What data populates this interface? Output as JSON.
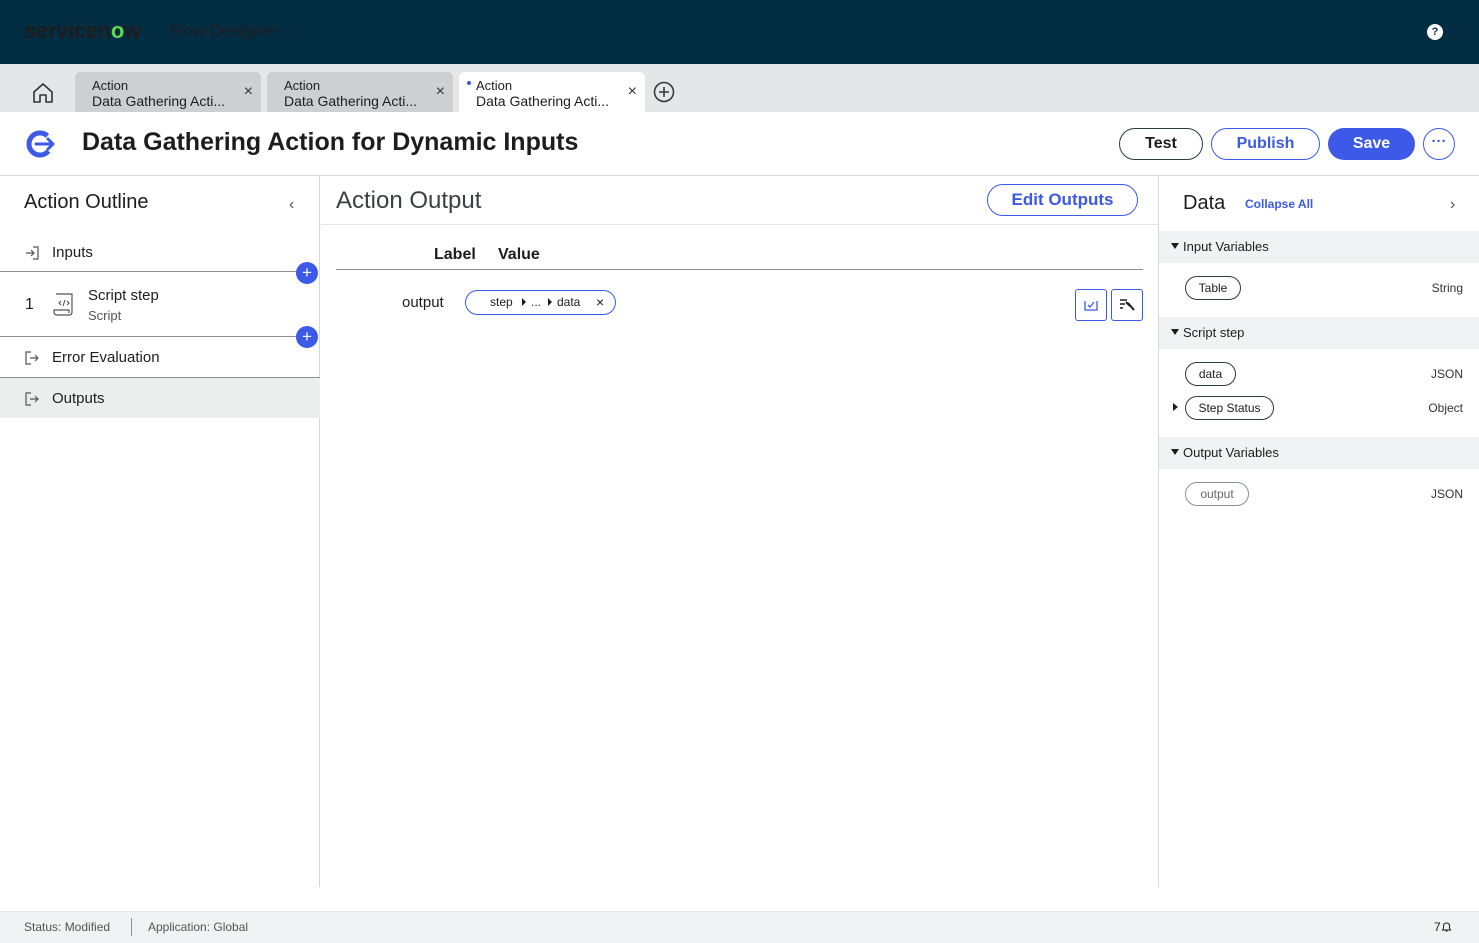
{
  "header": {
    "brand_prefix": "servicen",
    "brand_o": "o",
    "brand_suffix": "w",
    "product": "Flow Designer",
    "help": "?"
  },
  "tabs": [
    {
      "type": "Action",
      "title": "Data Gathering Acti...",
      "close": "×"
    },
    {
      "type": "Action",
      "title": "Data Gathering Acti...",
      "close": "×"
    },
    {
      "type": "Action",
      "title": "Data Gathering Acti...",
      "close": "×"
    }
  ],
  "titlebar": {
    "title": "Data Gathering Action for Dynamic Inputs",
    "test": "Test",
    "publish": "Publish",
    "save": "Save",
    "more": "···"
  },
  "outline": {
    "title": "Action Outline",
    "collapse": "‹",
    "inputs": "Inputs",
    "step_number": "1",
    "step_name": "Script step",
    "step_sub": "Script",
    "error_evaluation": "Error Evaluation",
    "outputs": "Outputs",
    "plus": "+"
  },
  "center": {
    "title": "Action Output",
    "edit_outputs": "Edit Outputs",
    "col_label": "Label",
    "col_value": "Value",
    "row_label": "output",
    "pill_part1": "step",
    "pill_part2": "...",
    "pill_part3": "data",
    "pill_close": "×"
  },
  "data_panel": {
    "title": "Data",
    "collapse_all": "Collapse All",
    "collapse": "›",
    "sections": [
      {
        "label": "Input Variables",
        "items": [
          {
            "name": "Table",
            "type": "String"
          }
        ]
      },
      {
        "label": "Script step",
        "items": [
          {
            "name": "data",
            "type": "JSON"
          },
          {
            "name": "Step Status",
            "type": "Object"
          }
        ]
      },
      {
        "label": "Output Variables",
        "items": [
          {
            "name": "output",
            "type": "JSON"
          }
        ]
      }
    ]
  },
  "status": {
    "status": "Status: Modified",
    "application": "Application: Global",
    "notifications": "7"
  },
  "colors": {
    "header_bg": "#032d42",
    "accent": "#3c59e7",
    "brand_green": "#62d84e"
  }
}
